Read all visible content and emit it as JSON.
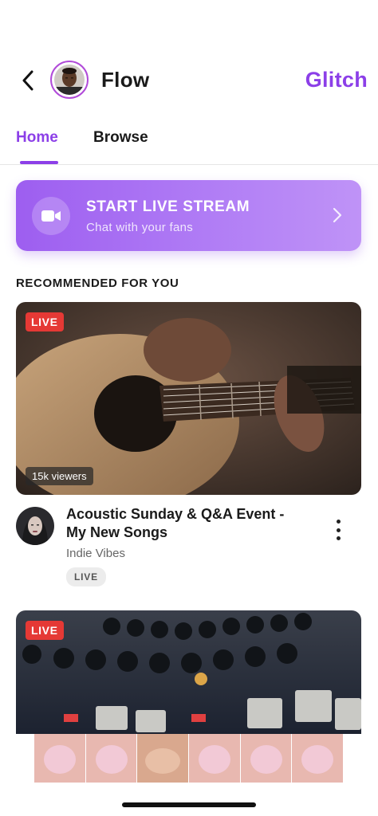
{
  "header": {
    "back_icon": "chevron-left-icon",
    "channel_name": "Flow",
    "brand": "Glitch"
  },
  "tabs": [
    {
      "label": "Home",
      "active": true
    },
    {
      "label": "Browse",
      "active": false
    }
  ],
  "live_banner": {
    "title": "START LIVE STREAM",
    "subtitle": "Chat with your fans",
    "icon": "video-camera-icon"
  },
  "section_title": "RECOMMENDED FOR YOU",
  "videos": [
    {
      "badge": "LIVE",
      "viewers": "15k viewers",
      "title": "Acoustic Sunday & Q&A Event - My New Songs",
      "channel": "Indie Vibes",
      "tag": "LIVE"
    },
    {
      "badge": "LIVE"
    }
  ],
  "colors": {
    "accent": "#8c3fe8",
    "live_red": "#e53935",
    "banner_start": "#9d5ef0",
    "banner_end": "#bf93f7"
  }
}
